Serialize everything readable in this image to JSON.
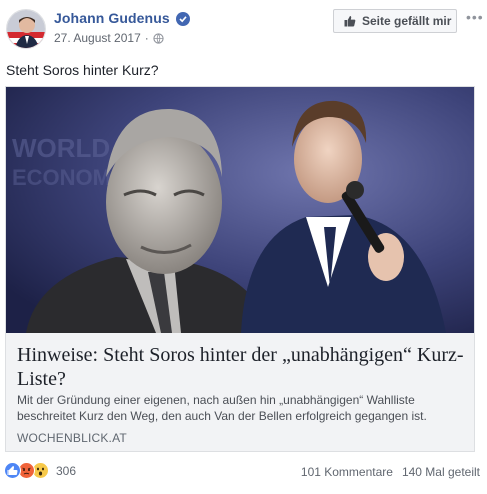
{
  "post": {
    "author": "Johann Gudenus",
    "date": "27. August 2017",
    "separator": "·",
    "privacy_icon": "globe-icon",
    "verified_icon": "verified-badge-icon",
    "like_page_label": "Seite gefällt mir",
    "more_label": "•••",
    "text": "Steht Soros hinter Kurz?"
  },
  "link_card": {
    "title": "Hinweise: Steht Soros hinter der „unabhängigen“ Kurz-Liste?",
    "description": "Mit der Gründung einer eigenen, nach außen hin „unabhängigen“ Wahlliste beschreitet Kurz den Weg, den auch Van der Bellen erfolgreich gegangen ist.",
    "domain": "WOCHENBLICK.AT"
  },
  "footer": {
    "reactions": [
      "like",
      "angry",
      "wow"
    ],
    "reaction_count": "306",
    "comments": "101 Kommentare",
    "shares": "140 Mal geteilt"
  },
  "colors": {
    "link_blue": "#365899",
    "verified_blue": "#4267b2",
    "meta_gray": "#616770",
    "card_bg": "#f2f3f5"
  }
}
